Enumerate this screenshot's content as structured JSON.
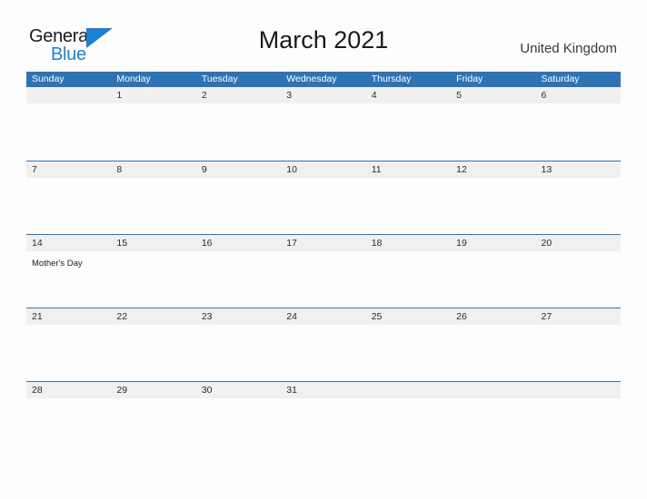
{
  "brand": {
    "name_part1": "General",
    "name_part2": "Blue",
    "flag_icon": "blue-triangle-flag-icon",
    "color_dark": "#1b1b1b",
    "color_blue": "#1f7fd0"
  },
  "header": {
    "title": "March 2021",
    "country": "United Kingdom"
  },
  "theme": {
    "header_bar_color": "#2e74b5",
    "row_band_color": "#f0f0f0",
    "row_divider_color": "#2e74b5",
    "page_background": "#fdfdfd",
    "text_color": "#2b2b2b"
  },
  "calendar": {
    "month": "March",
    "year": "2021",
    "weekdays": [
      "Sunday",
      "Monday",
      "Tuesday",
      "Wednesday",
      "Thursday",
      "Friday",
      "Saturday"
    ],
    "weeks": [
      {
        "days": [
          {
            "num": "",
            "event": ""
          },
          {
            "num": "1",
            "event": ""
          },
          {
            "num": "2",
            "event": ""
          },
          {
            "num": "3",
            "event": ""
          },
          {
            "num": "4",
            "event": ""
          },
          {
            "num": "5",
            "event": ""
          },
          {
            "num": "6",
            "event": ""
          }
        ]
      },
      {
        "days": [
          {
            "num": "7",
            "event": ""
          },
          {
            "num": "8",
            "event": ""
          },
          {
            "num": "9",
            "event": ""
          },
          {
            "num": "10",
            "event": ""
          },
          {
            "num": "11",
            "event": ""
          },
          {
            "num": "12",
            "event": ""
          },
          {
            "num": "13",
            "event": ""
          }
        ]
      },
      {
        "days": [
          {
            "num": "14",
            "event": "Mother's Day"
          },
          {
            "num": "15",
            "event": ""
          },
          {
            "num": "16",
            "event": ""
          },
          {
            "num": "17",
            "event": ""
          },
          {
            "num": "18",
            "event": ""
          },
          {
            "num": "19",
            "event": ""
          },
          {
            "num": "20",
            "event": ""
          }
        ]
      },
      {
        "days": [
          {
            "num": "21",
            "event": ""
          },
          {
            "num": "22",
            "event": ""
          },
          {
            "num": "23",
            "event": ""
          },
          {
            "num": "24",
            "event": ""
          },
          {
            "num": "25",
            "event": ""
          },
          {
            "num": "26",
            "event": ""
          },
          {
            "num": "27",
            "event": ""
          }
        ]
      },
      {
        "days": [
          {
            "num": "28",
            "event": ""
          },
          {
            "num": "29",
            "event": ""
          },
          {
            "num": "30",
            "event": ""
          },
          {
            "num": "31",
            "event": ""
          },
          {
            "num": "",
            "event": ""
          },
          {
            "num": "",
            "event": ""
          },
          {
            "num": "",
            "event": ""
          }
        ]
      }
    ]
  }
}
